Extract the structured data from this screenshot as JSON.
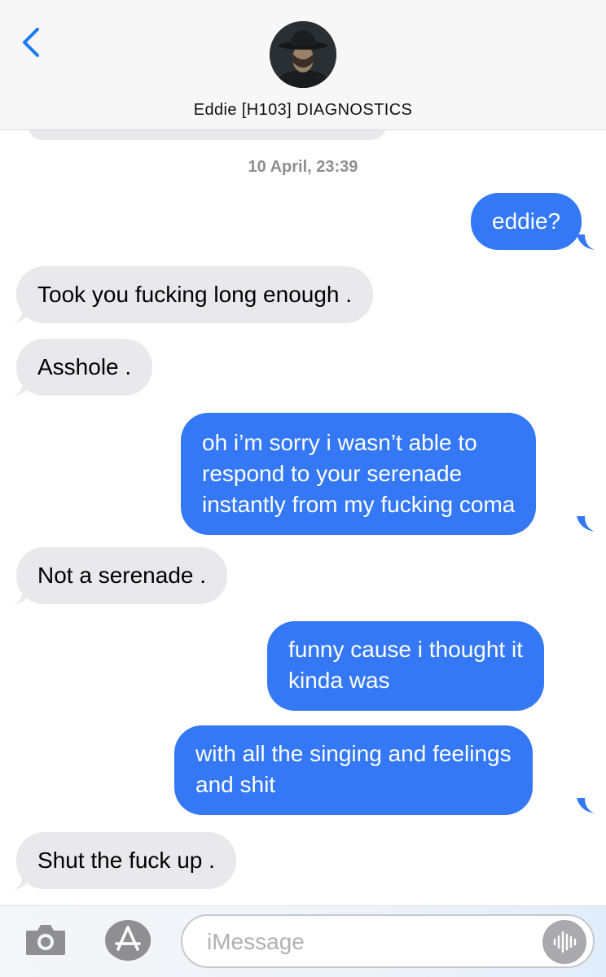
{
  "header": {
    "back_icon": "chevron-left-icon",
    "contact_name": "Eddie [H103] DIAGNOSTICS"
  },
  "thread": {
    "timestamp": "10 April, 23:39",
    "messages": [
      {
        "direction": "out",
        "lines": [
          "eddie?"
        ]
      },
      {
        "direction": "in",
        "lines": [
          "Took you fucking long enough ."
        ]
      },
      {
        "direction": "in",
        "lines": [
          "Asshole ."
        ]
      },
      {
        "direction": "out",
        "lines": [
          "oh i’m sorry i wasn’t able to",
          "respond to your serenade",
          "instantly from my fucking coma"
        ]
      },
      {
        "direction": "in",
        "lines": [
          "Not a serenade ."
        ]
      },
      {
        "direction": "out",
        "lines": [
          "funny cause i thought it",
          "kinda was"
        ]
      },
      {
        "direction": "out",
        "lines": [
          "with all the singing and feelings",
          "and shit"
        ]
      },
      {
        "direction": "in",
        "lines": [
          "Shut the fuck up ."
        ]
      }
    ]
  },
  "input_bar": {
    "camera_icon": "camera-icon",
    "appstore_icon": "app-store-icon",
    "placeholder": "iMessage",
    "voice_icon": "audio-waveform-icon"
  },
  "colors": {
    "outgoing_bubble": "#3478f6",
    "incoming_bubble": "#e9e9eb",
    "accent": "#1a7cf5"
  }
}
